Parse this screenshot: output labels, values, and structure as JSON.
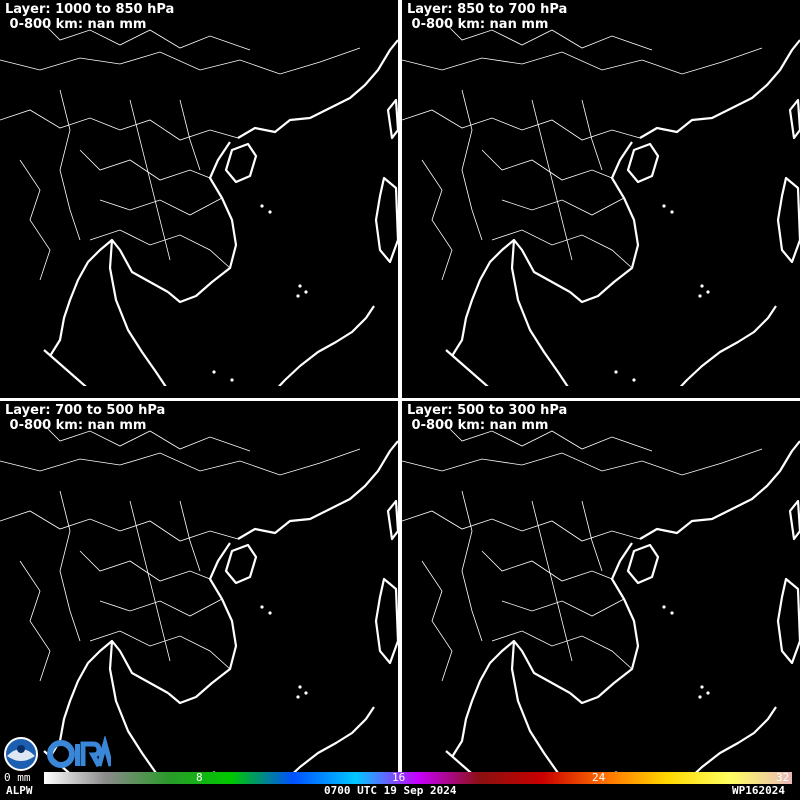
{
  "panels": [
    {
      "layer": "Layer: 1000 to 850 hPa",
      "stat": "0-800 km: nan mm"
    },
    {
      "layer": "Layer: 850 to 700 hPa",
      "stat": "0-800 km: nan mm"
    },
    {
      "layer": "Layer: 700 to 500 hPa",
      "stat": "0-800 km: nan mm"
    },
    {
      "layer": "Layer: 500 to 300 hPa",
      "stat": "0-800 km: nan mm"
    }
  ],
  "colorbar": {
    "unit_label": "0 mm",
    "ticks": [
      "8",
      "16",
      "24",
      "32"
    ],
    "colors": [
      "#ffffff",
      "#8a8a8a",
      "#2a9a2a",
      "#00c800",
      "#0050ff",
      "#00c8ff",
      "#c800ff",
      "#8a1010",
      "#c80000",
      "#ff7000",
      "#ffd700",
      "#ffff60",
      "#e8b8b8"
    ]
  },
  "footer": {
    "product": "ALPW",
    "timestamp": "0700 UTC 19 Sep 2024",
    "storm_id": "WP162024"
  },
  "logos": [
    "noaa-logo",
    "cira-logo"
  ]
}
